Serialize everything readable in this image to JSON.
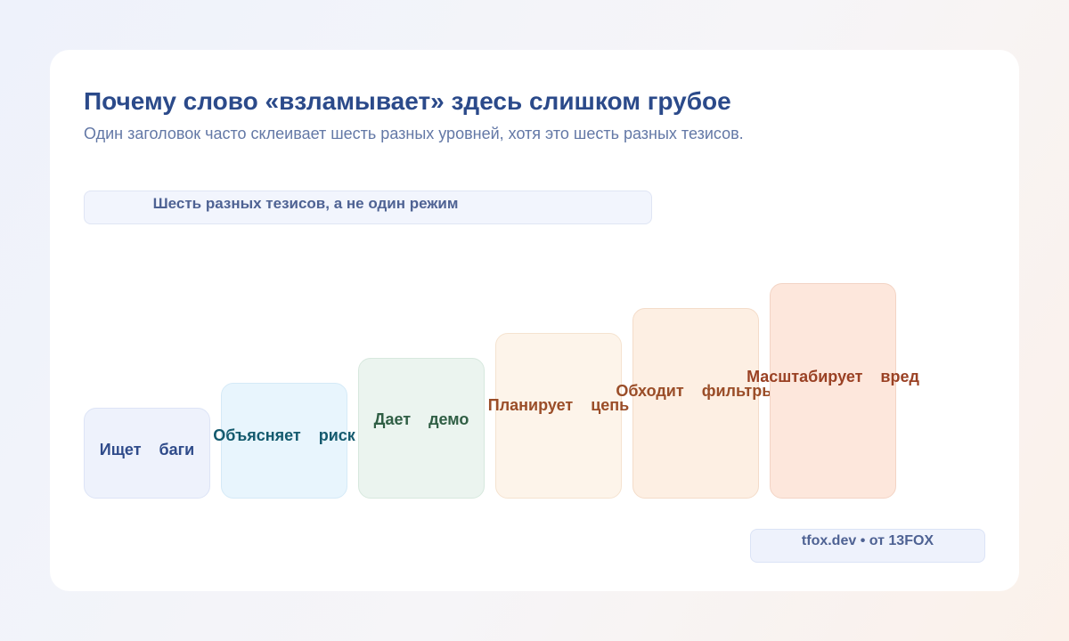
{
  "header": {
    "title": "Почему слово «взламывает» здесь слишком грубое",
    "subtitle": "Один заголовок часто склеивает шесть разных уровней, хотя это шесть разных тезисов."
  },
  "banner": {
    "label": "Шесть разных тезисов, а не один режим"
  },
  "steps": [
    {
      "label": "Ищет    баги"
    },
    {
      "label": "Объясняет    риск"
    },
    {
      "label": "Дает    демо"
    },
    {
      "label": "Планирует    цепь"
    },
    {
      "label": "Обходит    фильтры"
    },
    {
      "label": "Масштабирует    вред"
    }
  ],
  "footer": {
    "credit": "tfox.dev • от 13FOX"
  }
}
